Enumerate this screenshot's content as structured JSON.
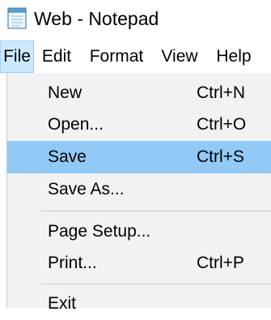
{
  "window": {
    "title": "Web - Notepad",
    "icon": "notepad-icon"
  },
  "menubar": {
    "items": [
      {
        "label": "File"
      },
      {
        "label": "Edit"
      },
      {
        "label": "Format"
      },
      {
        "label": "View"
      },
      {
        "label": "Help"
      }
    ]
  },
  "file_menu": {
    "items": [
      {
        "label": "New",
        "shortcut": "Ctrl+N"
      },
      {
        "label": "Open...",
        "shortcut": "Ctrl+O"
      },
      {
        "label": "Save",
        "shortcut": "Ctrl+S"
      },
      {
        "label": "Save As...",
        "shortcut": ""
      },
      {
        "label": "Page Setup...",
        "shortcut": ""
      },
      {
        "label": "Print...",
        "shortcut": "Ctrl+P"
      },
      {
        "label": "Exit",
        "shortcut": ""
      }
    ]
  },
  "colors": {
    "menu_background": "#f2f2f2",
    "highlight": "#91c9f7",
    "active_menubar": "#cce8ff"
  }
}
